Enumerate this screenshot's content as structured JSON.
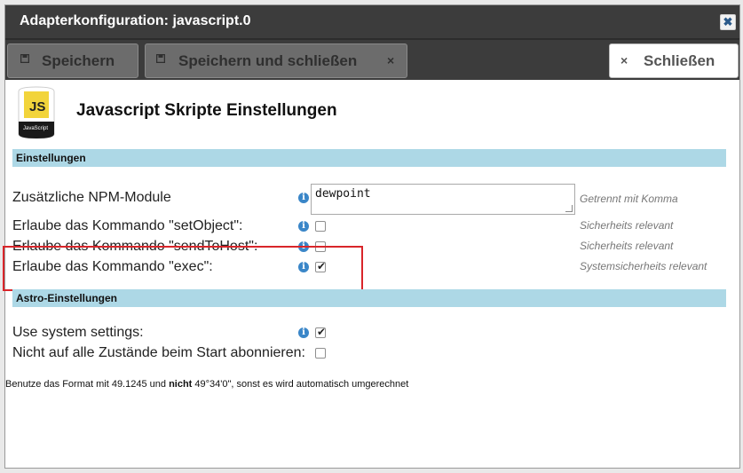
{
  "dialog": {
    "title": "Adapterkonfiguration: javascript.0",
    "close_glyph": "✖"
  },
  "toolbar": {
    "save_label": "Speichern",
    "save_close_label": "Speichern und schließen",
    "save_close_x": "×",
    "close_x": "×",
    "close_label": "Schließen"
  },
  "logo": {
    "text": "JS",
    "caption": "JavaScript"
  },
  "heading": "Javascript Skripte Einstellungen",
  "sections": {
    "settings": "Einstellungen",
    "astro": "Astro-Einstellungen"
  },
  "settings": {
    "npm": {
      "label": "Zusätzliche NPM-Module",
      "value": "dewpoint",
      "hint": "Getrennt mit Komma"
    },
    "setObject": {
      "label": "Erlaube das Kommando \"setObject\":",
      "checked": false,
      "hint": "Sicherheits relevant"
    },
    "sendToHost": {
      "label": "Erlaube das Kommando \"sendToHost\":",
      "checked": false,
      "hint": "Sicherheits relevant"
    },
    "exec": {
      "label": "Erlaube das Kommando \"exec\":",
      "checked": true,
      "hint": "Systemsicherheits relevant"
    }
  },
  "astro": {
    "useSystem": {
      "label": "Use system settings:",
      "checked": true
    },
    "noSubscribe": {
      "label": "Nicht auf alle Zustände beim Start abonnieren:",
      "checked": false
    }
  },
  "footer": {
    "part1": "Benutze das Format mit 49.1245 und ",
    "bold": "nicht",
    "part2": " 49°34'0\", sonst es wird automatisch umgerechnet"
  },
  "icons": {
    "info": "info-icon",
    "save": "save-icon",
    "close": "close-icon"
  },
  "colors": {
    "titlebar": "#3c3c3c",
    "section": "#add8e6",
    "info": "#3a86c8",
    "highlight": "#d9252a",
    "js_yellow": "#f2d43b"
  }
}
